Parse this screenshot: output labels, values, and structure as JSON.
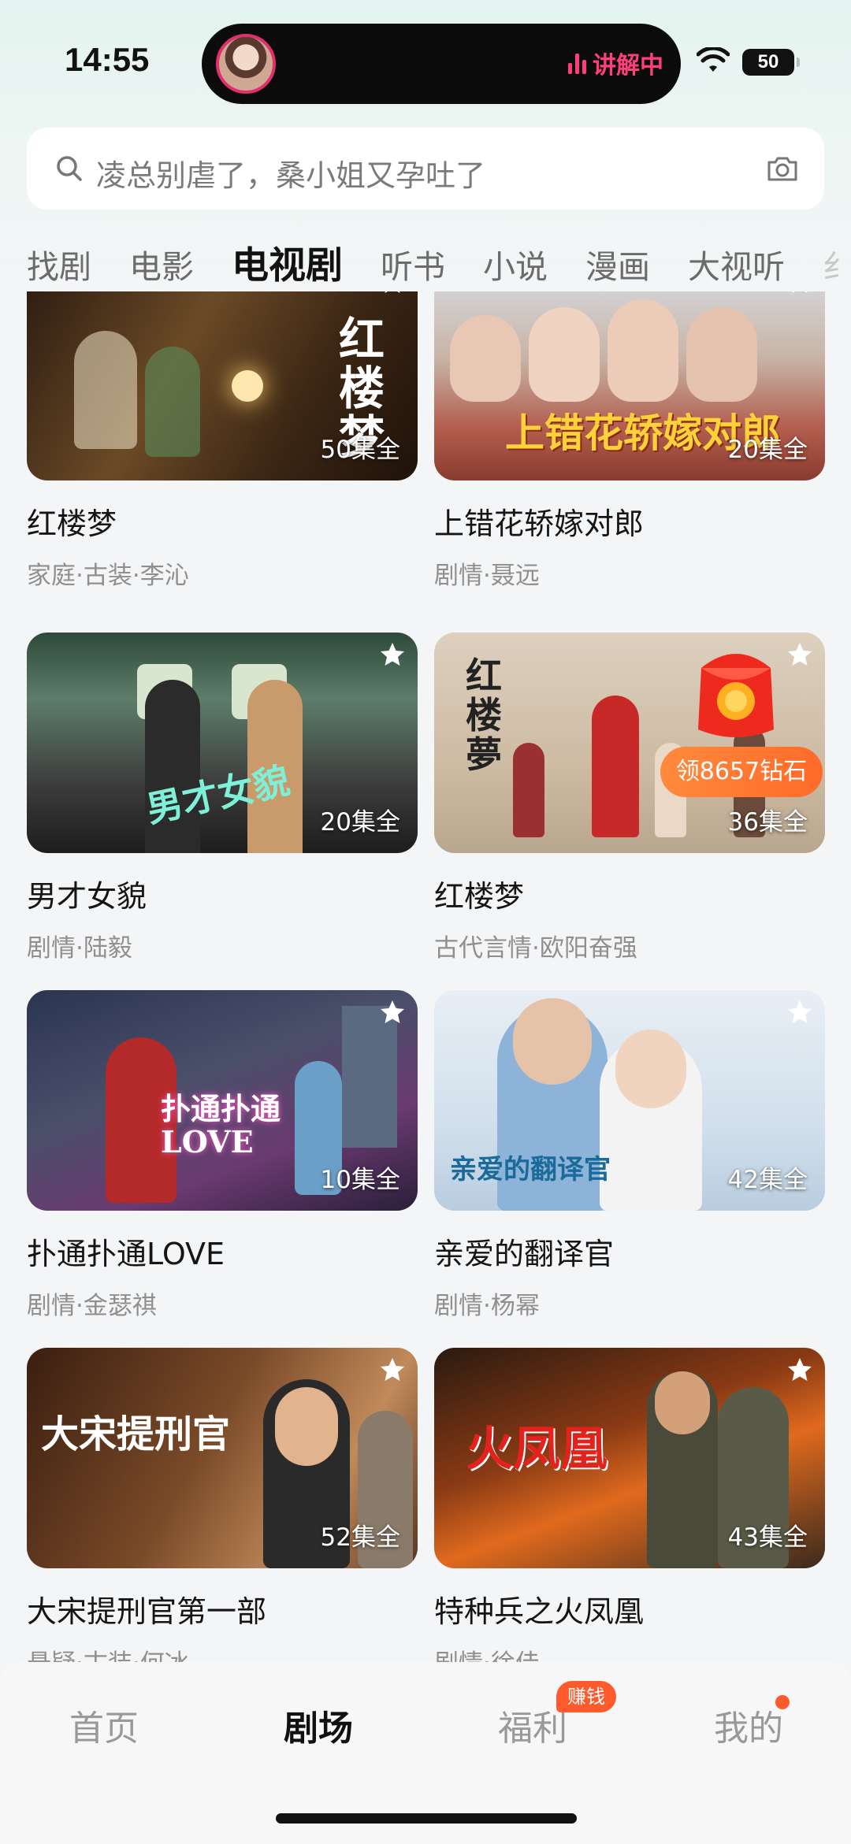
{
  "status_bar": {
    "time": "14:55",
    "live_label": "讲解中",
    "battery": "50"
  },
  "search": {
    "placeholder": "凌总别虐了，桑小姐又孕吐了"
  },
  "tabs": [
    "找剧",
    "电影",
    "电视剧",
    "听书",
    "小说",
    "漫画",
    "大视听",
    "纟"
  ],
  "active_tab": "电视剧",
  "dramas": [
    {
      "title": "红楼梦",
      "meta": "家庭·古装·李沁",
      "episodes": "50集全",
      "art": "红楼梦"
    },
    {
      "title": "上错花轿嫁对郎",
      "meta": "剧情·聂远",
      "episodes": "20集全",
      "art": "上错花轿嫁对郎"
    },
    {
      "title": "男才女貌",
      "meta": "剧情·陆毅",
      "episodes": "20集全",
      "art": "男才女貌"
    },
    {
      "title": "红楼梦",
      "meta": "古代言情·欧阳奋强",
      "episodes": "36集全",
      "art": "红楼夢"
    },
    {
      "title": "扑通扑通LOVE",
      "meta": "剧情·金瑟祺",
      "episodes": "10集全",
      "art": "扑通扑通LOVE"
    },
    {
      "title": "亲爱的翻译官",
      "meta": "剧情·杨幂",
      "episodes": "42集全",
      "art": "亲爱的翻译官"
    },
    {
      "title": "大宋提刑官第一部",
      "meta": "悬疑·古装·何冰",
      "episodes": "52集全",
      "art": "大宋提刑官"
    },
    {
      "title": "特种兵之火凤凰",
      "meta": "剧情·徐佳",
      "episodes": "43集全",
      "art": "火凤凰"
    }
  ],
  "promo": {
    "diamond_label": "领8657钻石"
  },
  "bottom_nav": {
    "items": [
      "首页",
      "剧场",
      "福利",
      "我的"
    ],
    "active": "剧场",
    "earn_badge": "赚钱"
  },
  "colors": {
    "accent": "#ff5a2c",
    "live": "#ff3f7b",
    "text_primary": "#151515",
    "text_secondary": "#8f8f8f"
  }
}
